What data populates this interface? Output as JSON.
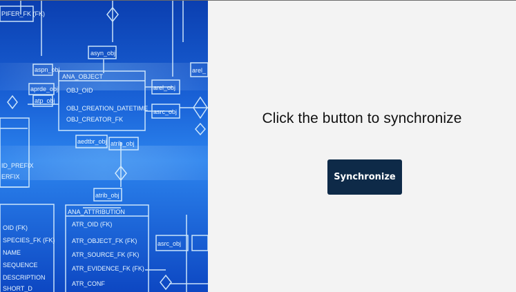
{
  "hero": {
    "icon": "database-schema-diagram",
    "labels": {
      "syn_obj": "asyn_obj",
      "rel_obj_top": "arel_",
      "rel_obj": "arel_obj",
      "src_obj": "asrc_obj",
      "ana_object": "ANA_OBJECT",
      "obj_oid": "OBJ_OID",
      "obj_creation": "OBJ_CREATION_DATETIME",
      "obj_creator": "OBJ_CREATOR_FK",
      "aedtbr": "aedtbr_obj",
      "atrib": "atrib_obj",
      "atrib2": "atrib_obj",
      "ana_attribution": "ANA_ATTRIBUTION",
      "atr_oid": "ATR_OID (FK)",
      "atr_object": "ATR_OBJECT_FK (FK)",
      "atr_source": "ATR_SOURCE_FK (FK)",
      "atr_evidence": "ATR_EVIDENCE_FK (FK)",
      "atr_conf": "ATR_CONF",
      "asrc_obj2": "asrc_obj",
      "left_1": "aspn_obj",
      "left_2": "aprde_obj",
      "left_3": "atp_obj",
      "left_4": "ID_PREFIX",
      "left_5": "ERFIX",
      "left_6": "OID (FK)",
      "left_7": "SPECIES_FK (FK)",
      "left_8": "NAME",
      "left_9": "SEQUENCE",
      "left_10": "DESCRIPTION",
      "left_11": "SHORT_D",
      "top_1": "PIFER_FK (FK)"
    }
  },
  "main": {
    "prompt": "Click the button to synchronize",
    "button_label": "Synchronize"
  }
}
